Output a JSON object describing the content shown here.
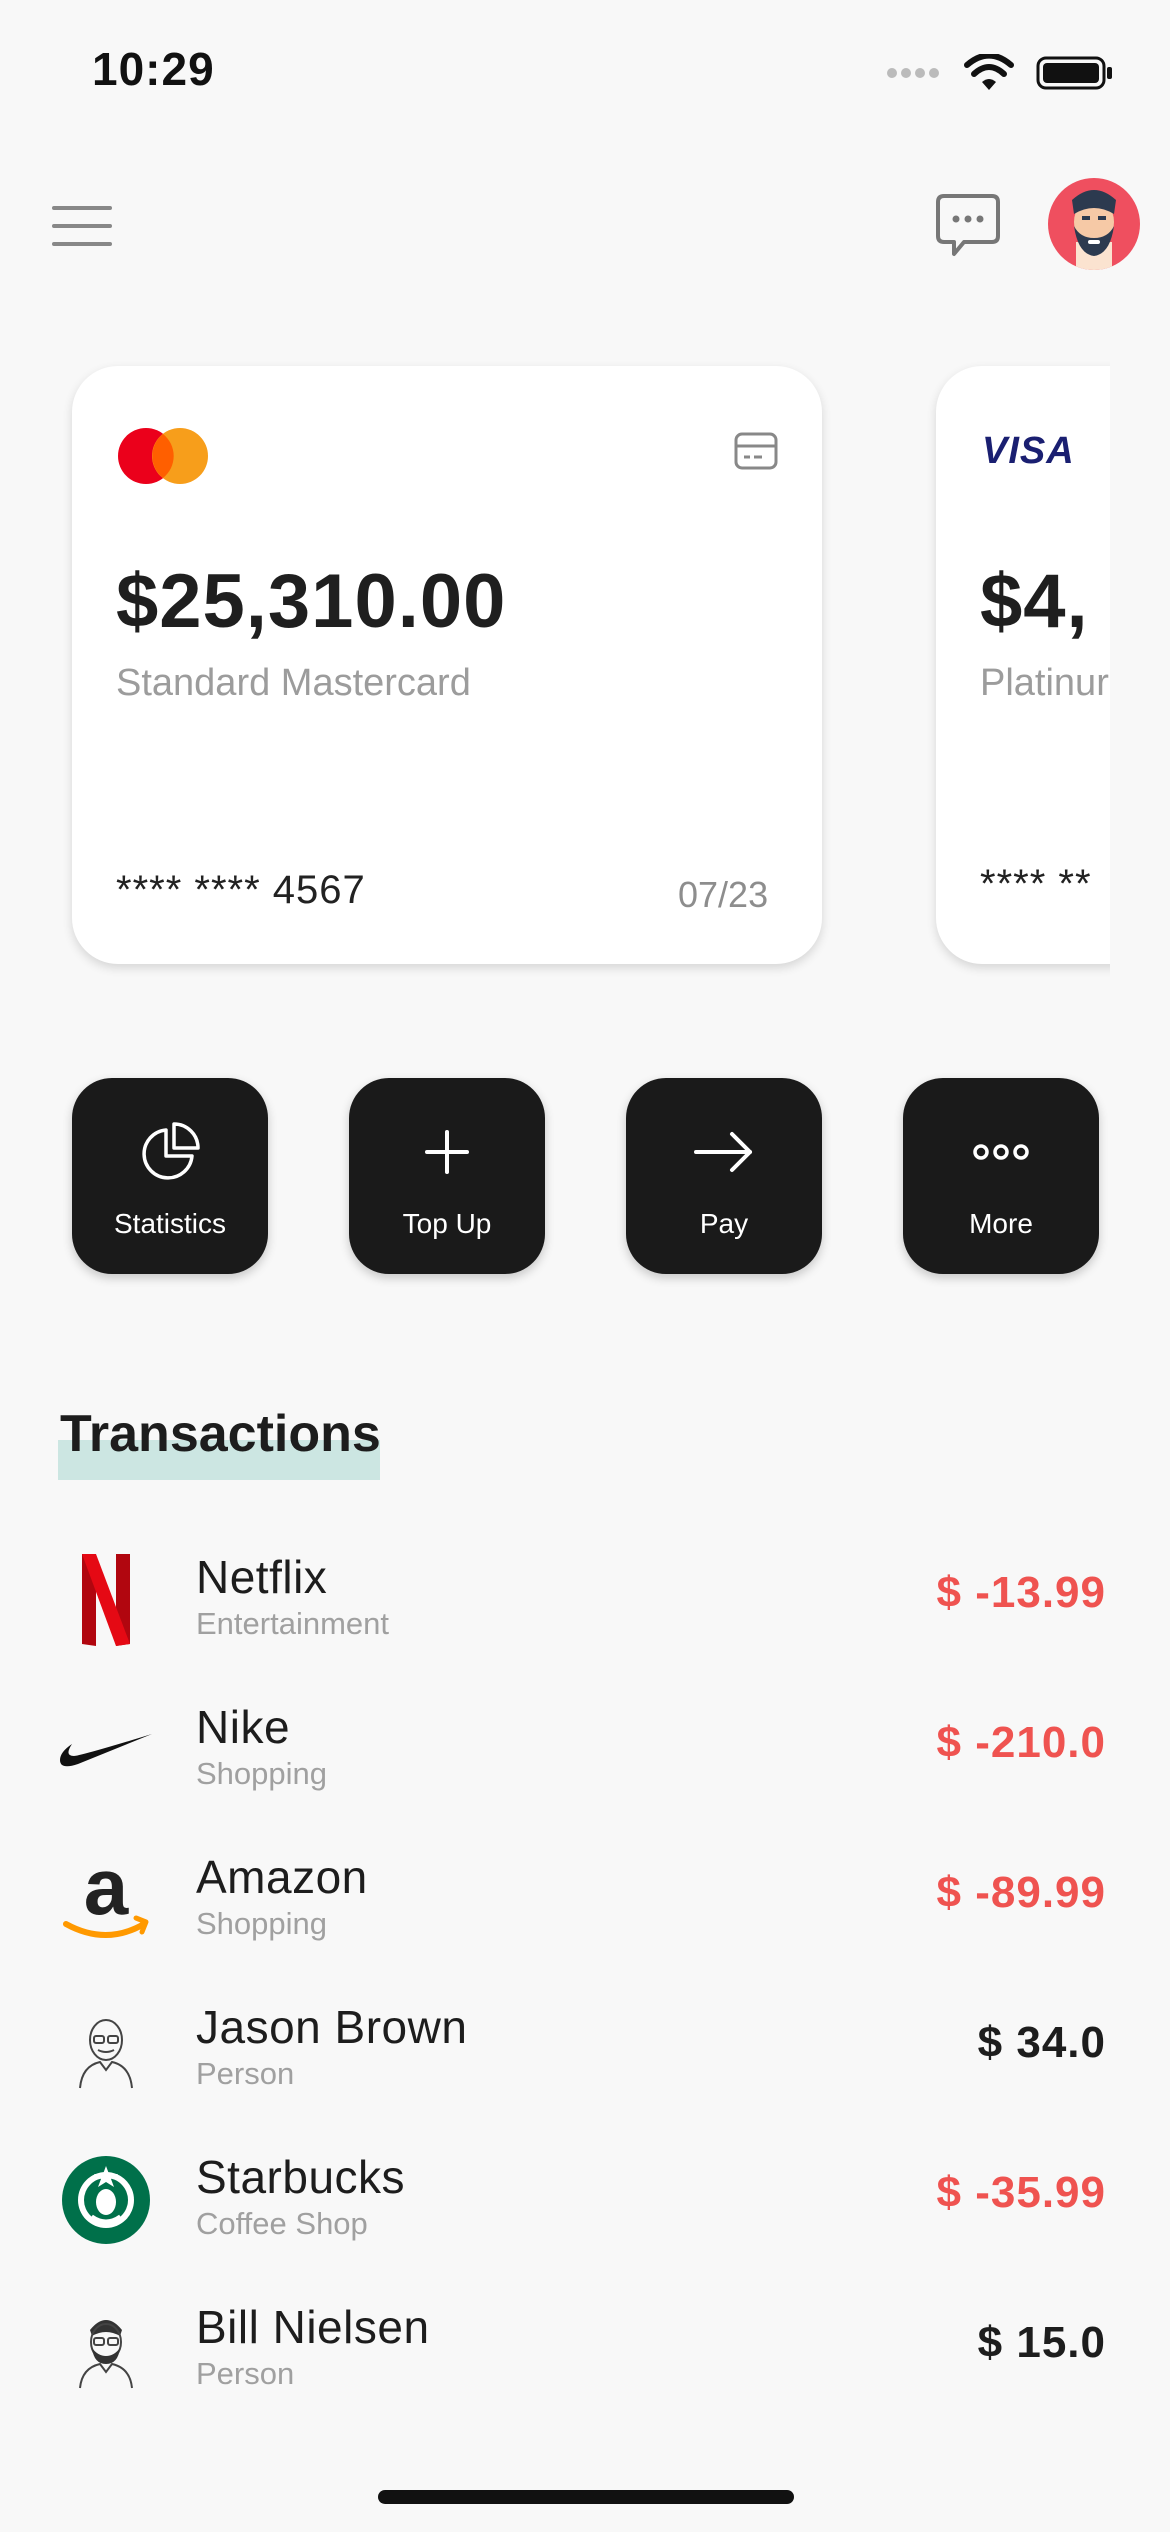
{
  "status_bar": {
    "time": "10:29"
  },
  "cards": [
    {
      "brand": "mastercard",
      "balance": "$25,310.00",
      "name": "Standard Mastercard",
      "number": "**** **** 4567",
      "expiry": "07/23"
    },
    {
      "brand": "visa",
      "brand_label": "VISA",
      "balance": "$4,",
      "name": "Platinur",
      "number": "**** **"
    }
  ],
  "actions": [
    {
      "label": "Statistics",
      "icon": "pie-chart-icon"
    },
    {
      "label": "Top Up",
      "icon": "plus-icon"
    },
    {
      "label": "Pay",
      "icon": "arrow-right-icon"
    },
    {
      "label": "More",
      "icon": "more-dots-icon"
    }
  ],
  "transactions": {
    "title": "Transactions",
    "items": [
      {
        "name": "Netflix",
        "category": "Entertainment",
        "amount": "$ -13.99",
        "type": "negative",
        "icon": "netflix-logo"
      },
      {
        "name": "Nike",
        "category": "Shopping",
        "amount": "$ -210.0",
        "type": "negative",
        "icon": "nike-logo"
      },
      {
        "name": "Amazon",
        "category": "Shopping",
        "amount": "$ -89.99",
        "type": "negative",
        "icon": "amazon-logo"
      },
      {
        "name": "Jason Brown",
        "category": "Person",
        "amount": "$ 34.0",
        "type": "positive",
        "icon": "person-avatar"
      },
      {
        "name": "Starbucks",
        "category": "Coffee Shop",
        "amount": "$ -35.99",
        "type": "negative",
        "icon": "starbucks-logo"
      },
      {
        "name": "Bill Nielsen",
        "category": "Person",
        "amount": "$ 15.0",
        "type": "positive",
        "icon": "person-avatar"
      }
    ]
  },
  "colors": {
    "negative": "#ef5350",
    "accent_highlight": "#cce6e2",
    "button_bg": "#1a1a1a"
  }
}
